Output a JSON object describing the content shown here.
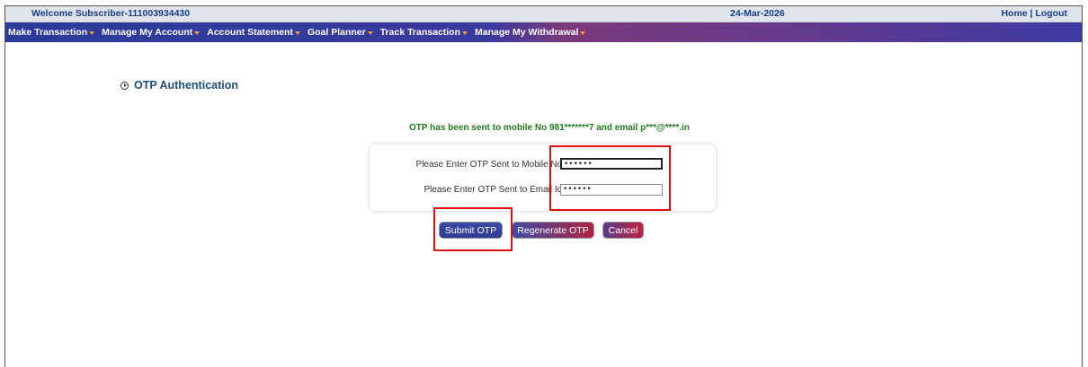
{
  "header": {
    "welcome": "Welcome Subscriber-111003934430",
    "date": "24-Mar-2026",
    "home": "Home",
    "separator": " | ",
    "logout": "Logout"
  },
  "nav": {
    "items": [
      {
        "label": "Make Transaction"
      },
      {
        "label": "Manage My Account"
      },
      {
        "label": "Account Statement"
      },
      {
        "label": "Goal Planner"
      },
      {
        "label": "Track Transaction"
      },
      {
        "label": "Manage My Withdrawal"
      }
    ],
    "caret_color": "#f0a030"
  },
  "main": {
    "title": "OTP Authentication",
    "otp_message": "OTP has been sent to mobile No 981*******7 and email p***@****.in",
    "mobile_label": "Please Enter OTP Sent to Mobile No:",
    "mobile_value": "••••••",
    "email_label": "Please Enter OTP Sent to Email Id:",
    "email_value": "••••••"
  },
  "buttons": {
    "submit": "Submit OTP",
    "regenerate": "Regenerate OTP",
    "cancel": "Cancel"
  },
  "colors": {
    "accent": "#2c3a9c",
    "success_text": "#1f7a1f",
    "highlight": "#e01010"
  }
}
